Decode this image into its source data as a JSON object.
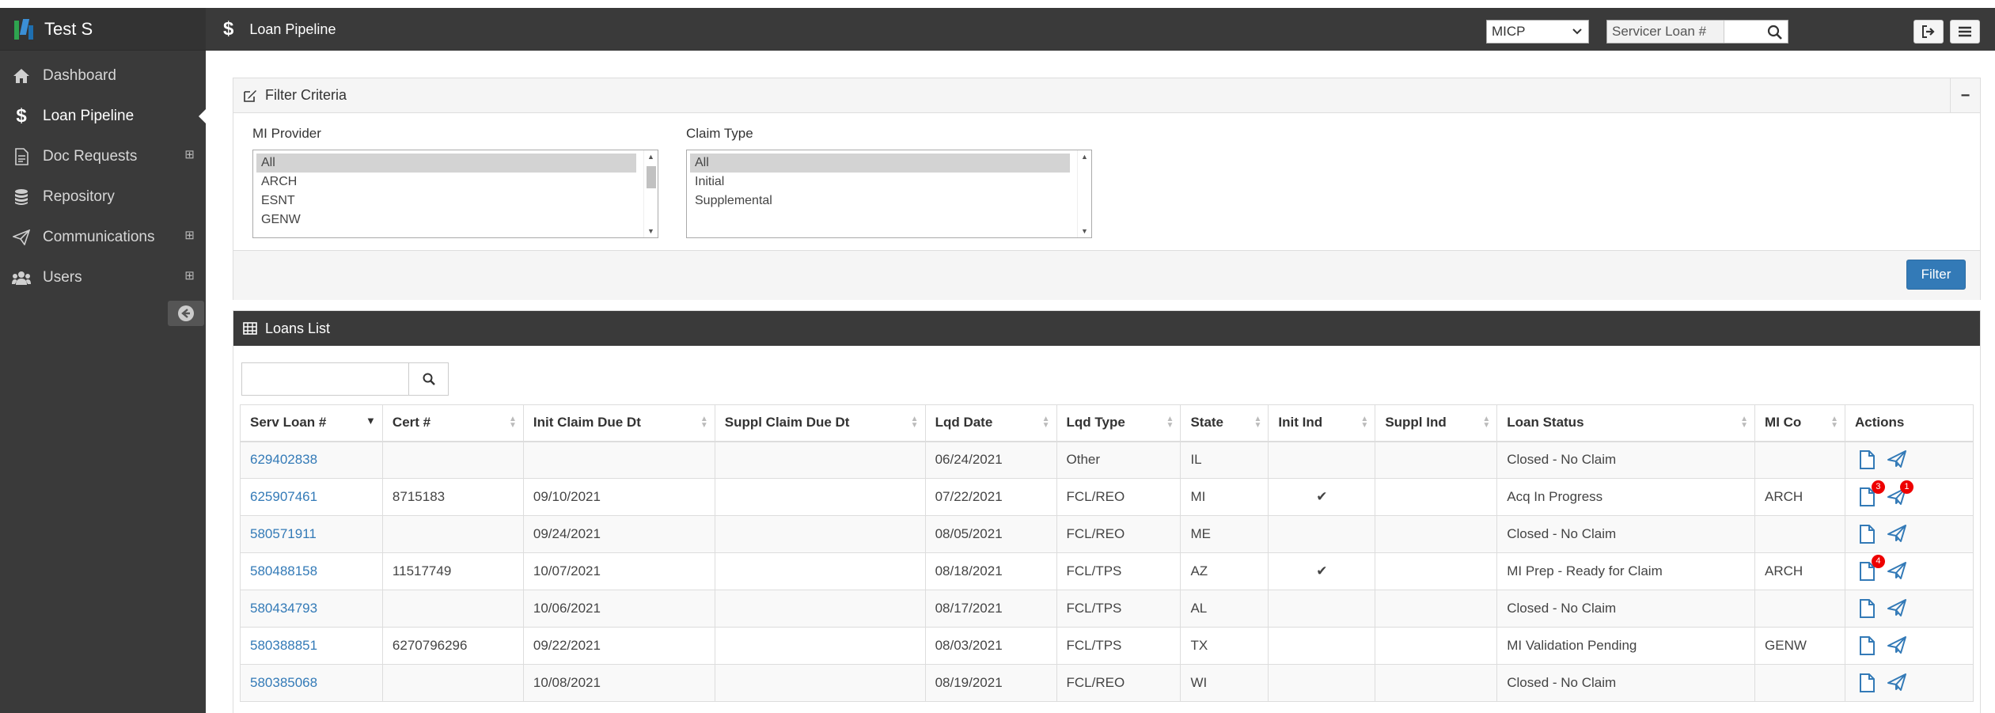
{
  "app": {
    "brand": "Test S",
    "page_title": "Loan Pipeline"
  },
  "sidebar": {
    "items": [
      {
        "label": "Dashboard",
        "icon": "home-icon",
        "active": false,
        "expandable": false
      },
      {
        "label": "Loan Pipeline",
        "icon": "dollar-icon",
        "active": true,
        "expandable": false
      },
      {
        "label": "Doc Requests",
        "icon": "document-icon",
        "active": false,
        "expandable": true
      },
      {
        "label": "Repository",
        "icon": "database-icon",
        "active": false,
        "expandable": false
      },
      {
        "label": "Communications",
        "icon": "paper-plane-icon",
        "active": false,
        "expandable": true
      },
      {
        "label": "Users",
        "icon": "users-icon",
        "active": false,
        "expandable": true
      }
    ],
    "expand_symbol": "⊞"
  },
  "topbar": {
    "mi_select_value": "MICP",
    "search_label": "Servicer Loan #",
    "search_value": ""
  },
  "filter": {
    "title": "Filter Criteria",
    "collapse_symbol": "−",
    "mi_provider_label": "MI Provider",
    "mi_provider_options": [
      "All",
      "ARCH",
      "ESNT",
      "GENW"
    ],
    "claim_type_label": "Claim Type",
    "claim_type_options": [
      "All",
      "Initial",
      "Supplemental"
    ],
    "filter_button": "Filter"
  },
  "loans": {
    "title": "Loans List",
    "search_value": "",
    "columns": [
      "Serv Loan #",
      "Cert #",
      "Init Claim Due Dt",
      "Suppl Claim Due Dt",
      "Lqd Date",
      "Lqd Type",
      "State",
      "Init Ind",
      "Suppl Ind",
      "Loan Status",
      "MI Co",
      "Actions"
    ],
    "rows": [
      {
        "serv_loan": "629402838",
        "cert": "",
        "init_due": "",
        "suppl_due": "",
        "lqd_date": "06/24/2021",
        "lqd_type": "Other",
        "state": "IL",
        "init_ind": "",
        "suppl_ind": "",
        "status": "Closed - No Claim",
        "mi_co": "",
        "doc_badge": "",
        "send_badge": ""
      },
      {
        "serv_loan": "625907461",
        "cert": "8715183",
        "init_due": "09/10/2021",
        "suppl_due": "",
        "lqd_date": "07/22/2021",
        "lqd_type": "FCL/REO",
        "state": "MI",
        "init_ind": "✔",
        "suppl_ind": "",
        "status": "Acq In Progress",
        "mi_co": "ARCH",
        "doc_badge": "3",
        "send_badge": "1"
      },
      {
        "serv_loan": "580571911",
        "cert": "",
        "init_due": "09/24/2021",
        "suppl_due": "",
        "lqd_date": "08/05/2021",
        "lqd_type": "FCL/REO",
        "state": "ME",
        "init_ind": "",
        "suppl_ind": "",
        "status": "Closed - No Claim",
        "mi_co": "",
        "doc_badge": "",
        "send_badge": ""
      },
      {
        "serv_loan": "580488158",
        "cert": "11517749",
        "init_due": "10/07/2021",
        "suppl_due": "",
        "lqd_date": "08/18/2021",
        "lqd_type": "FCL/TPS",
        "state": "AZ",
        "init_ind": "✔",
        "suppl_ind": "",
        "status": "MI Prep - Ready for Claim",
        "mi_co": "ARCH",
        "doc_badge": "4",
        "send_badge": ""
      },
      {
        "serv_loan": "580434793",
        "cert": "",
        "init_due": "10/06/2021",
        "suppl_due": "",
        "lqd_date": "08/17/2021",
        "lqd_type": "FCL/TPS",
        "state": "AL",
        "init_ind": "",
        "suppl_ind": "",
        "status": "Closed - No Claim",
        "mi_co": "",
        "doc_badge": "",
        "send_badge": ""
      },
      {
        "serv_loan": "580388851",
        "cert": "6270796296",
        "init_due": "09/22/2021",
        "suppl_due": "",
        "lqd_date": "08/03/2021",
        "lqd_type": "FCL/TPS",
        "state": "TX",
        "init_ind": "",
        "suppl_ind": "",
        "status": "MI Validation Pending",
        "mi_co": "GENW",
        "doc_badge": "",
        "send_badge": ""
      },
      {
        "serv_loan": "580385068",
        "cert": "",
        "init_due": "10/08/2021",
        "suppl_due": "",
        "lqd_date": "08/19/2021",
        "lqd_type": "FCL/REO",
        "state": "WI",
        "init_ind": "",
        "suppl_ind": "",
        "status": "Closed - No Claim",
        "mi_co": "",
        "doc_badge": "",
        "send_badge": ""
      }
    ]
  },
  "colors": {
    "sidebar_bg": "#3a3a3a",
    "link": "#337ab7",
    "primary_button": "#337ab7",
    "badge": "#e00000"
  }
}
